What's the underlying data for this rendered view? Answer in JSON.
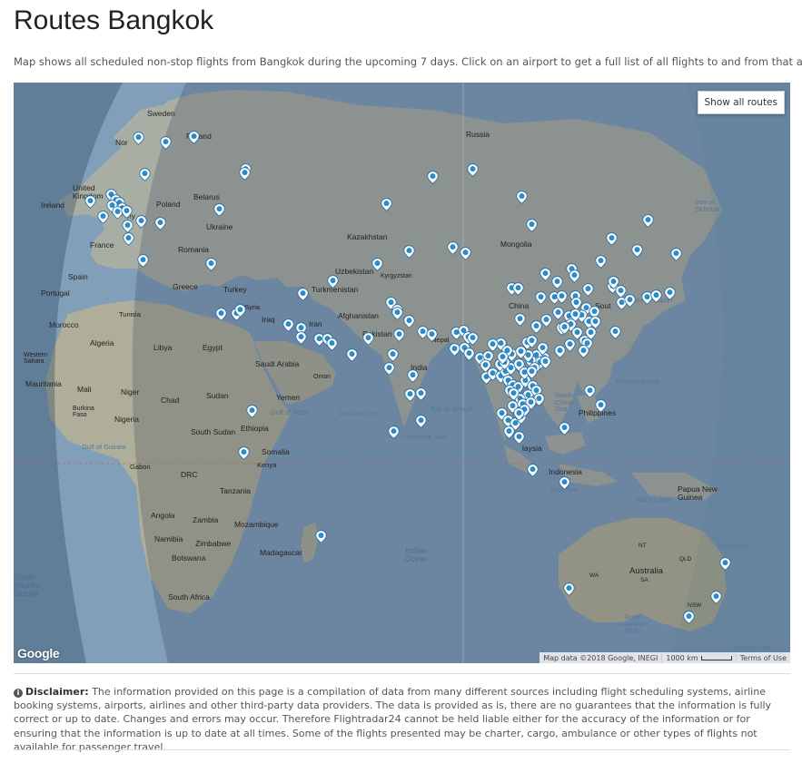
{
  "page": {
    "title": "Routes Bangkok",
    "subtitle": "Map shows all scheduled non-stop flights from Bangkok during the upcoming 7 days. Click on an airport to get a full list of all flights to and from that airport."
  },
  "map": {
    "show_all_label": "Show all routes",
    "google_logo": "Google",
    "attribution": "Map data ©2018 Google, INEGI",
    "scale_label": "1000 km",
    "terms_label": "Terms of Use",
    "labels": {
      "sweden": "Sweden",
      "finland": "Finland",
      "norway": "Nor",
      "russia": "Russia",
      "united_kingdom": "United\nKingdom",
      "ireland": "Ireland",
      "belarus": "Belarus",
      "poland": "Poland",
      "ukraine": "Ukraine",
      "germany": "ny",
      "france": "France",
      "romania": "Romania",
      "kazakhstan": "Kazakhstan",
      "mongolia": "Mongolia",
      "sea_of_okhotsk": "Sea of\nOkhotsk",
      "spain": "Spain",
      "portugal": "Portugal",
      "greece": "Greece",
      "turkey": "Turkey",
      "uzbekistan": "Uzbekistan",
      "kyrgyzstan": "Kyrgyzstan",
      "turkmenistan": "Turkmenistan",
      "tunisia": "Tunisia",
      "syria": "Syria",
      "iraq": "Iraq",
      "iran": "Iran",
      "afghanistan": "Afghanistan",
      "china": "China",
      "south_korea": "Sout",
      "sea_of_japan": "Sea of Japan",
      "morocco": "Morocco",
      "algeria": "Algeria",
      "libya": "Libya",
      "egypt": "Egypt",
      "saudi_arabia": "Saudi Arabia",
      "oman": "Oman",
      "pakistan": "Pakistan",
      "nepal": "Nepal",
      "india": "India",
      "western_sahara": "Western\nSahara",
      "mauritania": "Mauritania",
      "mali": "Mali",
      "niger": "Niger",
      "chad": "Chad",
      "sudan": "Sudan",
      "yemen": "Yemen",
      "gulf_of_aden": "Gulf of Aden",
      "arabian_sea": "Arabian Sea",
      "bay_of_bengal": "Bay of Bengal",
      "south_china_sea": "South\nChina\nSea",
      "philippine_sea": "Philippine Sea",
      "philippines": "Philippines",
      "burkina_faso": "Burkina\nFaso",
      "nigeria": "Nigeria",
      "south_sudan": "South Sudan",
      "ethiopia": "Ethiopia",
      "somalia": "Somalia",
      "gulf_of_guinea": "Gulf of Guinea",
      "laccadive_sea": "Laccadive Sea",
      "malaysia": "laysia",
      "gabon": "Gabon",
      "drc": "DRC",
      "kenya": "Kenya",
      "tanzania": "Tanzania",
      "indonesia": "Indonesia",
      "papua_new_guinea": "Papua New\nGuinea",
      "java_sea": "Java Sea",
      "arafura_sea": "Arafura Sea",
      "angola": "Angola",
      "zambia": "Zambia",
      "mozambique": "Mozambique",
      "namibia": "Namibia",
      "zimbabwe": "Zimbabwe",
      "botswana": "Botswana",
      "madagascar": "Madagascar",
      "indian_ocean": "Indian\nOcean",
      "south_atlantic": "South\nAtlantic\nOcean",
      "south_africa": "South Africa",
      "coral_sea": "Coral Sea",
      "nt": "NT",
      "qld": "QLD",
      "wa": "WA",
      "sa": "SA",
      "nsw": "NSW",
      "australia": "Australia",
      "great_australian_bight": "Great\nAustralian\nBight",
      "tasman_sea": "Tasman Sea"
    },
    "pin_count": 176
  },
  "disclaimer": {
    "heading": "Disclaimer:",
    "text": "The information provided on this page is a compilation of data from many different sources including flight scheduling systems, airline booking systems, airports, airlines and other third-party data providers. The data is provided as is, there are no guarantees that the information is fully correct or up to date. Changes and errors may occur. Therefore Flightradar24 cannot be held liable either for the accuracy of the information or for ensuring that the information is up to date at all times. Some of the flights presented may be charter, cargo, ambulance or other types of flights not available for passenger travel."
  },
  "colors": {
    "ocean": "#98b4cc",
    "land": "#c9c7b3",
    "night_overlay": "#2b4a6f",
    "pin": "#2a8bc9"
  }
}
